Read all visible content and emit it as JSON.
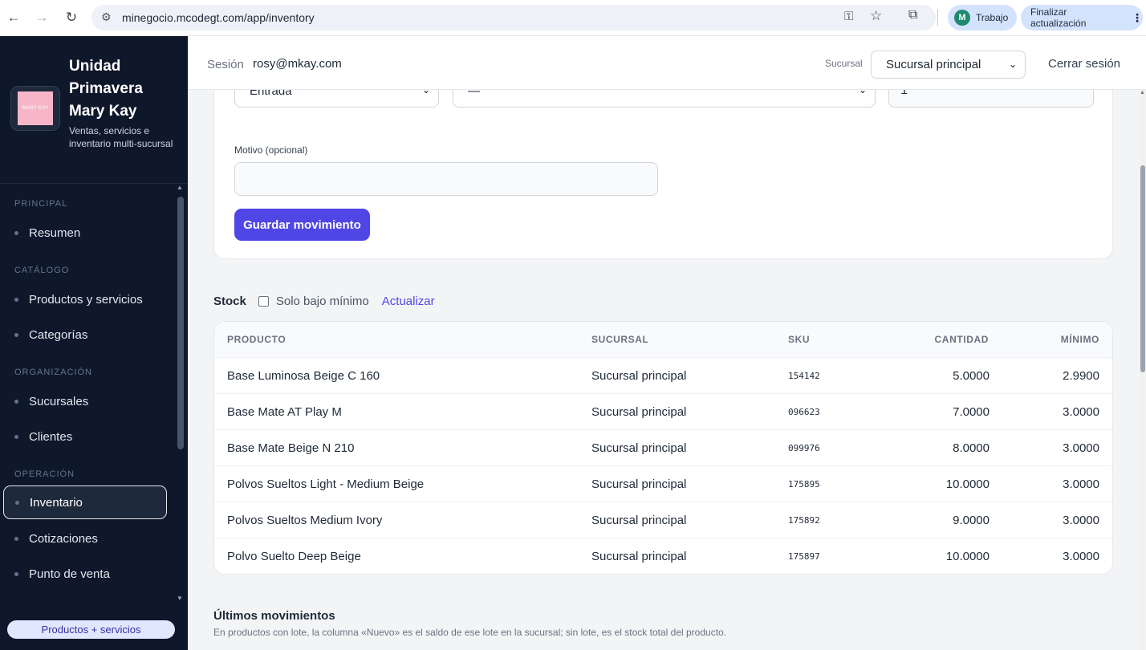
{
  "browser": {
    "url": "minegocio.mcodegt.com/app/inventory",
    "profile_initial": "M",
    "profile_name": "Trabajo",
    "update_label": "Finalizar actualización"
  },
  "sidebar": {
    "logo_text": "MARY KAY",
    "title": "Unidad Primavera Mary Kay",
    "subtitle": "Ventas, servicios e inventario multi-sucursal",
    "sections": {
      "principal": "PRINCIPAL",
      "catalogo": "CATÁLOGO",
      "organizacion": "ORGANIZACIÓN",
      "operacion": "OPERACIÓN"
    },
    "items": {
      "resumen": "Resumen",
      "productos": "Productos y servicios",
      "categorias": "Categorías",
      "sucursales": "Sucursales",
      "clientes": "Clientes",
      "inventario": "Inventario",
      "cotizaciones": "Cotizaciones",
      "punto_venta": "Punto de venta"
    },
    "footer_pill": "Productos + servicios"
  },
  "header": {
    "session_label": "Sesión",
    "session_email": "rosy@mkay.com",
    "branch_label": "Sucursal",
    "branch_value": "Sucursal principal",
    "logout": "Cerrar sesión"
  },
  "form": {
    "type_value": "Entrada",
    "product_value": "—",
    "quantity_value": "1",
    "motivo_label": "Motivo (opcional)",
    "save_label": "Guardar movimiento"
  },
  "stock": {
    "title": "Stock",
    "filter_label": "Solo bajo mínimo",
    "refresh_label": "Actualizar",
    "columns": {
      "producto": "PRODUCTO",
      "sucursal": "SUCURSAL",
      "sku": "SKU",
      "cantidad": "CANTIDAD",
      "minimo": "MÍNIMO"
    },
    "rows": [
      {
        "producto": "Base Luminosa Beige C 160",
        "sucursal": "Sucursal principal",
        "sku": "154142",
        "cantidad": "5.0000",
        "minimo": "2.9900"
      },
      {
        "producto": "Base Mate AT Play M",
        "sucursal": "Sucursal principal",
        "sku": "096623",
        "cantidad": "7.0000",
        "minimo": "3.0000"
      },
      {
        "producto": "Base Mate Beige N 210",
        "sucursal": "Sucursal principal",
        "sku": "099976",
        "cantidad": "8.0000",
        "minimo": "3.0000"
      },
      {
        "producto": "Polvos Sueltos Light - Medium Beige",
        "sucursal": "Sucursal principal",
        "sku": "175895",
        "cantidad": "10.0000",
        "minimo": "3.0000"
      },
      {
        "producto": "Polvos Sueltos Medium Ivory",
        "sucursal": "Sucursal principal",
        "sku": "175892",
        "cantidad": "9.0000",
        "minimo": "3.0000"
      },
      {
        "producto": "Polvo Suelto Deep Beige",
        "sucursal": "Sucursal principal",
        "sku": "175897",
        "cantidad": "10.0000",
        "minimo": "3.0000"
      }
    ]
  },
  "movements": {
    "title": "Últimos movimientos",
    "subtitle": "En productos con lote, la columna «Nuevo» es el saldo de ese lote en la sucursal; sin lote, es el stock total del producto."
  },
  "colors": {
    "accent": "#4f46e5",
    "sidebar_bg": "#0f172a",
    "logo_pink": "#f7b6c8"
  },
  "icons": [
    "back-arrow-icon",
    "forward-arrow-icon",
    "reload-icon",
    "site-settings-icon",
    "key-icon",
    "star-icon",
    "extensions-icon",
    "menu-dots-icon",
    "chevron-down-icon"
  ]
}
